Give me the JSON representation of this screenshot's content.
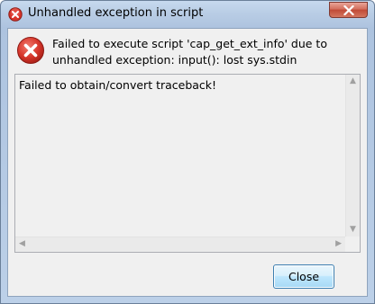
{
  "window": {
    "title": "Unhandled exception in script",
    "title_icon": "error-icon"
  },
  "dialog": {
    "icon": "error-icon",
    "message": "Failed to execute script 'cap_get_ext_info' due to unhandled exception: input(): lost sys.stdin",
    "details": "Failed to obtain/convert traceback!",
    "close_label": "Close"
  },
  "colors": {
    "error_red": "#d9352a",
    "button_border": "#3c7fb1"
  }
}
